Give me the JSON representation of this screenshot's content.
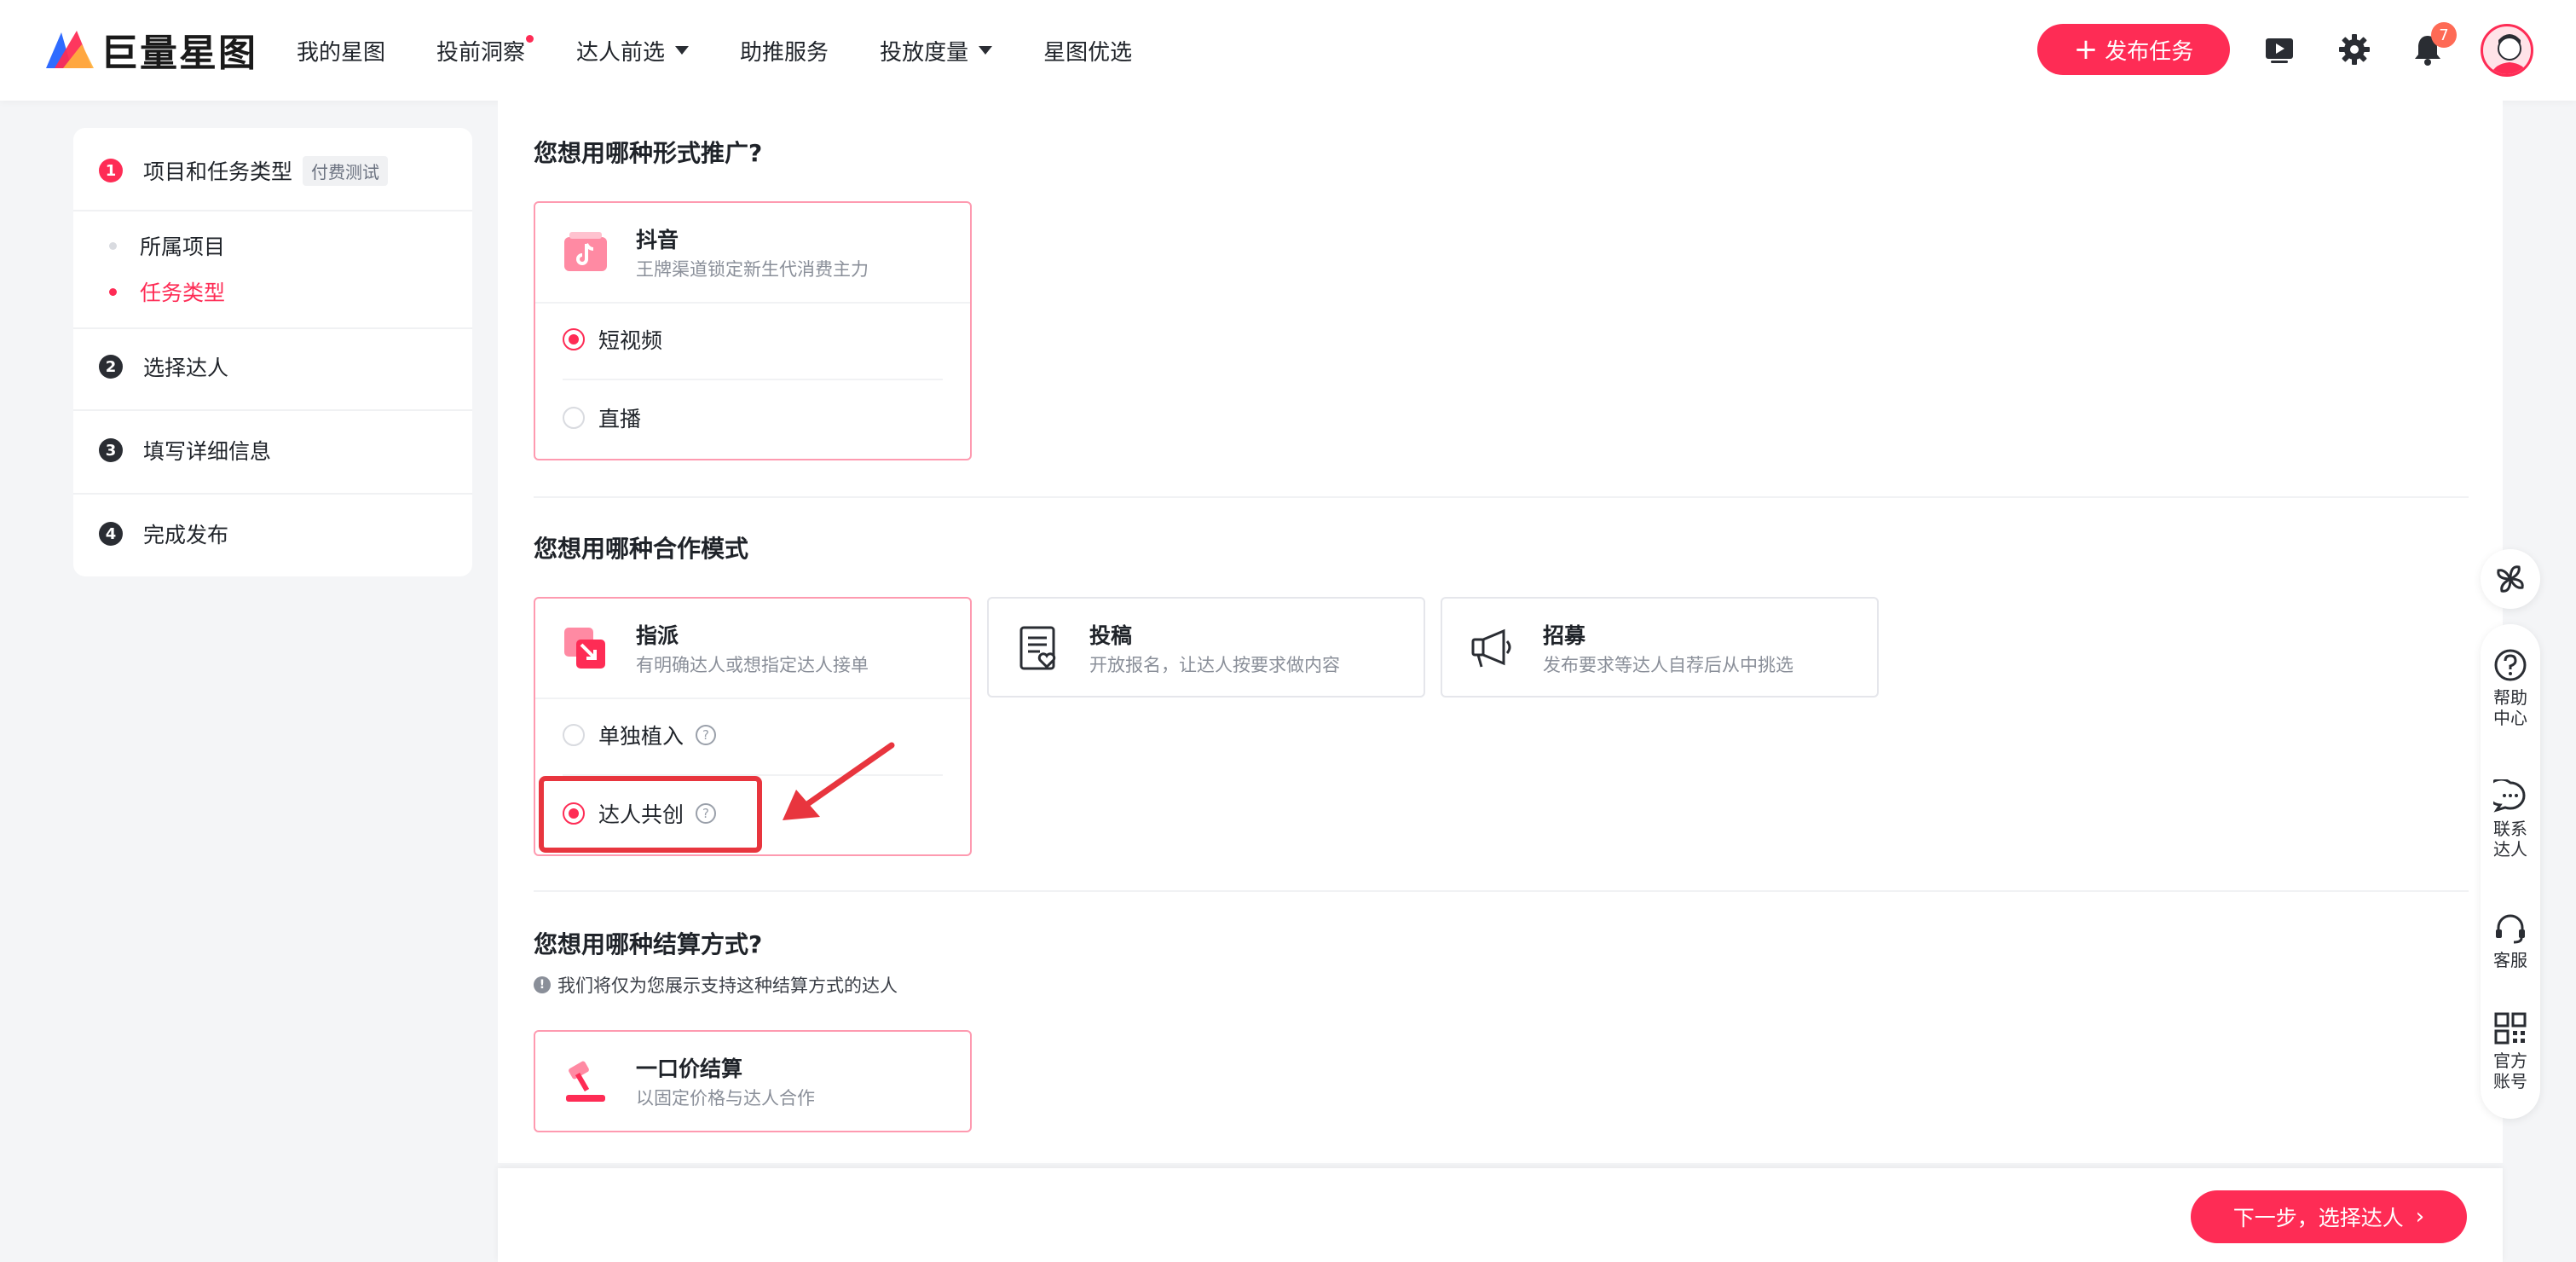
{
  "brand": {
    "name": "巨量星图",
    "accent": "#fe2c55"
  },
  "nav": {
    "items": [
      {
        "label": "我的星图",
        "dot": false,
        "caret": false
      },
      {
        "label": "投前洞察",
        "dot": true,
        "caret": false
      },
      {
        "label": "达人前选",
        "dot": false,
        "caret": true
      },
      {
        "label": "助推服务",
        "dot": false,
        "caret": false
      },
      {
        "label": "投放度量",
        "dot": false,
        "caret": true
      },
      {
        "label": "星图优选",
        "dot": false,
        "caret": false
      }
    ],
    "publish_label": "发布任务",
    "notification_count": "7",
    "icons": [
      "video-icon",
      "gear-icon",
      "bell-icon",
      "avatar"
    ]
  },
  "stepper": {
    "steps": [
      {
        "num": "1",
        "label": "项目和任务类型",
        "tag": "付费测试",
        "active": true
      },
      {
        "num": "2",
        "label": "选择达人"
      },
      {
        "num": "3",
        "label": "填写详细信息"
      },
      {
        "num": "4",
        "label": "完成发布"
      }
    ],
    "sub_steps": [
      {
        "label": "所属项目",
        "active": false
      },
      {
        "label": "任务类型",
        "active": true
      }
    ]
  },
  "promo_form": {
    "title": "您想用哪种形式推广?",
    "platform": {
      "name": "抖音",
      "desc": "王牌渠道锁定新生代消费主力"
    },
    "options": [
      {
        "label": "短视频",
        "checked": true
      },
      {
        "label": "直播",
        "checked": false
      }
    ]
  },
  "coop_mode": {
    "title": "您想用哪种合作模式",
    "cards": [
      {
        "name": "指派",
        "desc": "有明确达人或想指定达人接单",
        "selected": true
      },
      {
        "name": "投稿",
        "desc": "开放报名，让达人按要求做内容",
        "selected": false
      },
      {
        "name": "招募",
        "desc": "发布要求等达人自荐后从中挑选",
        "selected": false
      }
    ],
    "options": [
      {
        "label": "单独植入",
        "checked": false
      },
      {
        "label": "达人共创",
        "checked": true
      }
    ]
  },
  "settlement": {
    "title": "您想用哪种结算方式?",
    "hint": "我们将仅为您展示支持这种结算方式的达人",
    "card": {
      "name": "一口价结算",
      "desc": "以固定价格与达人合作"
    }
  },
  "footer": {
    "next_label": "下一步，选择达人"
  },
  "float_bar": {
    "items": [
      {
        "label": "帮助中心",
        "icon": "help-icon"
      },
      {
        "label": "联系达人",
        "icon": "chat-icon"
      },
      {
        "label": "客服",
        "icon": "headset-icon"
      },
      {
        "label": "官方账号",
        "icon": "qrcode-icon"
      }
    ]
  }
}
